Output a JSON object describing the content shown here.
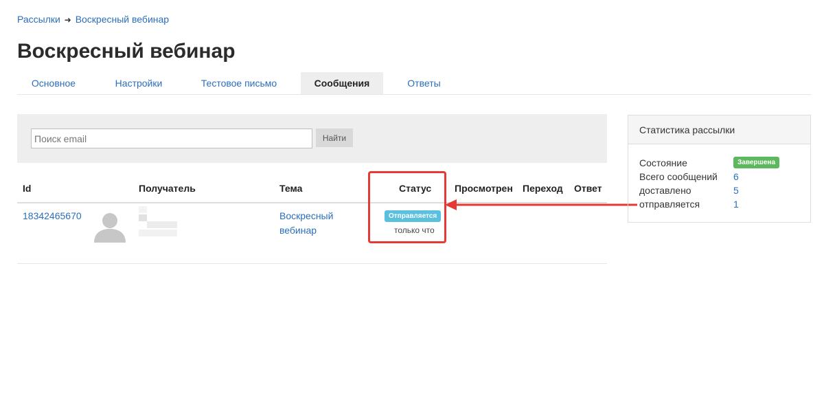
{
  "breadcrumb": {
    "parent": "Рассылки",
    "separator": "➜",
    "current": "Воскресный вебинар"
  },
  "page_title": "Воскресный вебинар",
  "tabs": [
    {
      "label": "Основное",
      "active": false
    },
    {
      "label": "Настройки",
      "active": false
    },
    {
      "label": "Тестовое письмо",
      "active": false
    },
    {
      "label": "Сообщения",
      "active": true
    },
    {
      "label": "Ответы",
      "active": false
    }
  ],
  "search": {
    "placeholder": "Поиск email",
    "value": "",
    "button_label": "Найти"
  },
  "table": {
    "columns": [
      "Id",
      "Получатель",
      "Тема",
      "Статус",
      "Просмотрен",
      "Переход",
      "Ответ"
    ],
    "rows": [
      {
        "id": "18342465670",
        "recipient": "",
        "subject": "Воскресный вебинар",
        "status": "Отправляется",
        "status_time": "только что",
        "viewed": "",
        "clicked": "",
        "replied": ""
      }
    ]
  },
  "stats": {
    "title": "Статистика рассылки",
    "state_label": "Состояние",
    "state_value": "Завершена",
    "total_label": "Всего сообщений",
    "total_value": "6",
    "delivered_label": "доставлено",
    "delivered_value": "5",
    "sending_label": "отправляется",
    "sending_value": "1"
  },
  "colors": {
    "link": "#2a6ebb",
    "badge_sending": "#5bc0de",
    "badge_done": "#5cb85c",
    "annotation": "#e53935"
  },
  "icons": {
    "avatar": "user-silhouette-icon",
    "breadcrumb_separator": "arrow-right-icon"
  }
}
